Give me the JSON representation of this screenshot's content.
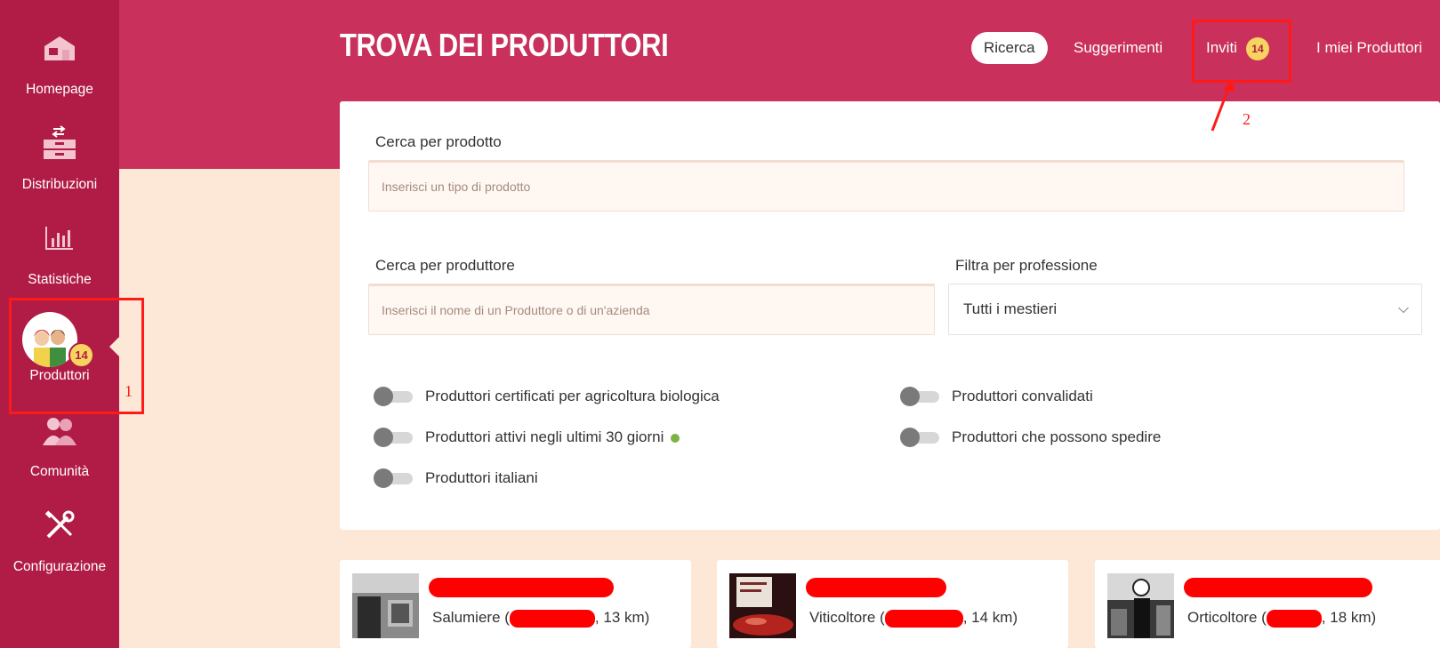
{
  "sidebar": {
    "items": [
      {
        "label": "Homepage",
        "icon": "home-icon"
      },
      {
        "label": "Distribuzioni",
        "icon": "boxes-exchange-icon"
      },
      {
        "label": "Statistiche",
        "icon": "bar-chart-icon"
      },
      {
        "label": "Produttori",
        "icon": "producers-avatar",
        "badge": "14"
      },
      {
        "label": "Comunità",
        "icon": "community-icon"
      },
      {
        "label": "Configurazione",
        "icon": "tools-icon"
      }
    ]
  },
  "header": {
    "title": "TROVA DEI PRODUTTORI",
    "tabs": [
      {
        "label": "Ricerca",
        "active": true
      },
      {
        "label": "Suggerimenti"
      },
      {
        "label": "Inviti",
        "badge": "14"
      },
      {
        "label": "I miei Produttori"
      }
    ]
  },
  "search": {
    "product_label": "Cerca per prodotto",
    "product_placeholder": "Inserisci un tipo di prodotto",
    "producer_label": "Cerca per produttore",
    "producer_placeholder": "Inserisci il nome di un Produttore o di un'azienda",
    "profession_label": "Filtra per professione",
    "profession_value": "Tutti i mestieri"
  },
  "filters": [
    {
      "label": "Produttori certificati per agricoltura biologica",
      "on": false
    },
    {
      "label": "Produttori convalidati",
      "on": false
    },
    {
      "label": "Produttori attivi negli ultimi 30 giorni",
      "on": false
    },
    {
      "label": "Produttori che possono spedire",
      "on": false
    },
    {
      "label": "Produttori italiani",
      "on": false
    }
  ],
  "producers": [
    {
      "profession": "Salumiere (",
      "distance": ", 13 km)"
    },
    {
      "profession": "Viticoltore (",
      "distance": ", 14 km)"
    },
    {
      "profession": "Orticoltore (",
      "distance": ", 18 km)"
    }
  ],
  "annotations": {
    "one": "1",
    "two": "2"
  },
  "colors": {
    "sidebar": "#b01c45",
    "header": "#c9305b",
    "background": "#fde8d7",
    "badge": "#f7d35f",
    "annotation": "#ff1a1a"
  }
}
